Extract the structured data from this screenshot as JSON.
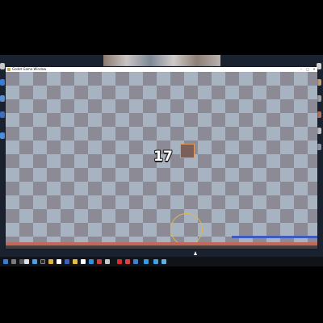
{
  "window": {
    "title": "Godot Game Window",
    "minimize_label": "–",
    "maximize_label": "□",
    "close_label": "✕"
  },
  "game": {
    "counter": "17"
  },
  "taskbar": {
    "time": "",
    "date": ""
  },
  "colors": {
    "checker_dark": "#8c8a95",
    "checker_light": "#a7b3c0",
    "player_fill": "#7a5f5a",
    "player_border": "#e09a5c",
    "floor": "#c0685a",
    "blue_bar": "#3f5bbf",
    "aim_ring": "#e0b84a"
  },
  "icons": [
    "start-icon",
    "search-icon",
    "task-view-icon",
    "file-explorer-icon",
    "browser-icon",
    "store-icon",
    "mail-icon",
    "app-icon"
  ]
}
